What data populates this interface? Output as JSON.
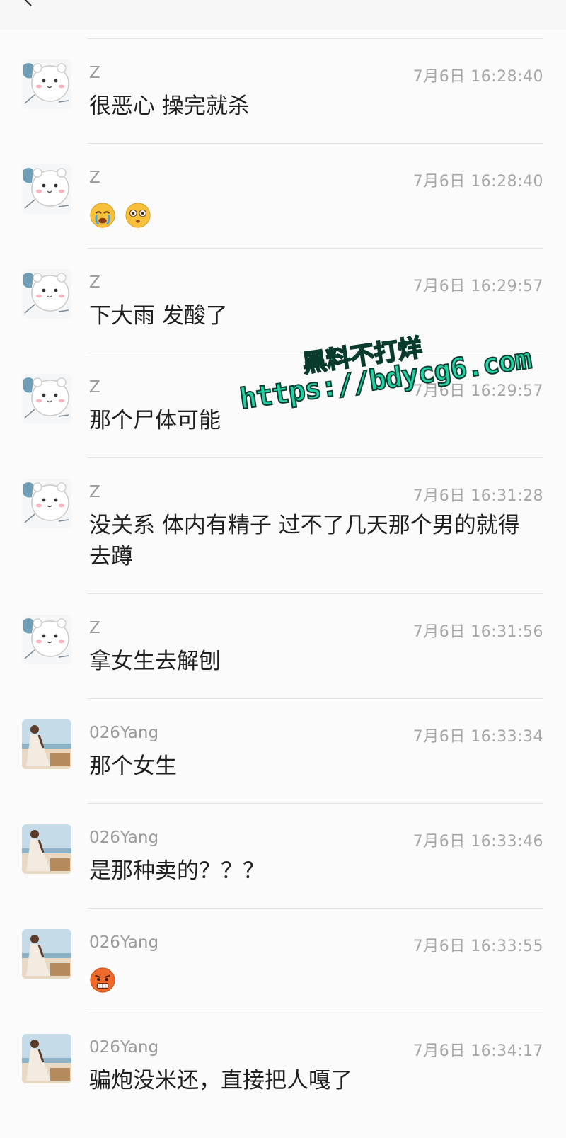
{
  "messages": [
    {
      "sender": "Z",
      "time": "7月6日 16:28:40",
      "text": "很恶心 操完就杀",
      "avatar": "bear-avatar",
      "emojis": []
    },
    {
      "sender": "Z",
      "time": "7月6日 16:28:40",
      "text": "",
      "avatar": "bear-avatar",
      "emojis": [
        "crying-face-emoji",
        "flushed-face-emoji"
      ]
    },
    {
      "sender": "Z",
      "time": "7月6日 16:29:57",
      "text": "下大雨 发酸了",
      "avatar": "bear-avatar",
      "emojis": []
    },
    {
      "sender": "Z",
      "time": "7月6日 16:29:57",
      "text": "那个尸体可能",
      "avatar": "bear-avatar",
      "emojis": []
    },
    {
      "sender": "Z",
      "time": "7月6日 16:31:28",
      "text": "没关系 体内有精子 过不了几天那个男的就得去蹲",
      "avatar": "bear-avatar",
      "emojis": []
    },
    {
      "sender": "Z",
      "time": "7月6日 16:31:56",
      "text": "拿女生去解刨",
      "avatar": "bear-avatar",
      "emojis": []
    },
    {
      "sender": "026Yang",
      "time": "7月6日 16:33:34",
      "text": "那个女生",
      "avatar": "photo-avatar",
      "emojis": []
    },
    {
      "sender": "026Yang",
      "time": "7月6日 16:33:46",
      "text": "是那种卖的？？？",
      "avatar": "photo-avatar",
      "emojis": []
    },
    {
      "sender": "026Yang",
      "time": "7月6日 16:33:55",
      "text": "",
      "avatar": "photo-avatar",
      "emojis": [
        "worried-angry-face-emoji"
      ]
    },
    {
      "sender": "026Yang",
      "time": "7月6日 16:34:17",
      "text": "骗炮没米还，直接把人嘎了",
      "avatar": "photo-avatar",
      "emojis": []
    }
  ],
  "watermark": {
    "line1": "黑料不打烊",
    "line2": "https://bdycg6.com"
  },
  "colors": {
    "background": "#fbfbfb",
    "separator": "#e3e3e3",
    "meta_text": "#a7a7a7",
    "message_text": "#1f1f1f",
    "watermark": "#20d3a6"
  }
}
